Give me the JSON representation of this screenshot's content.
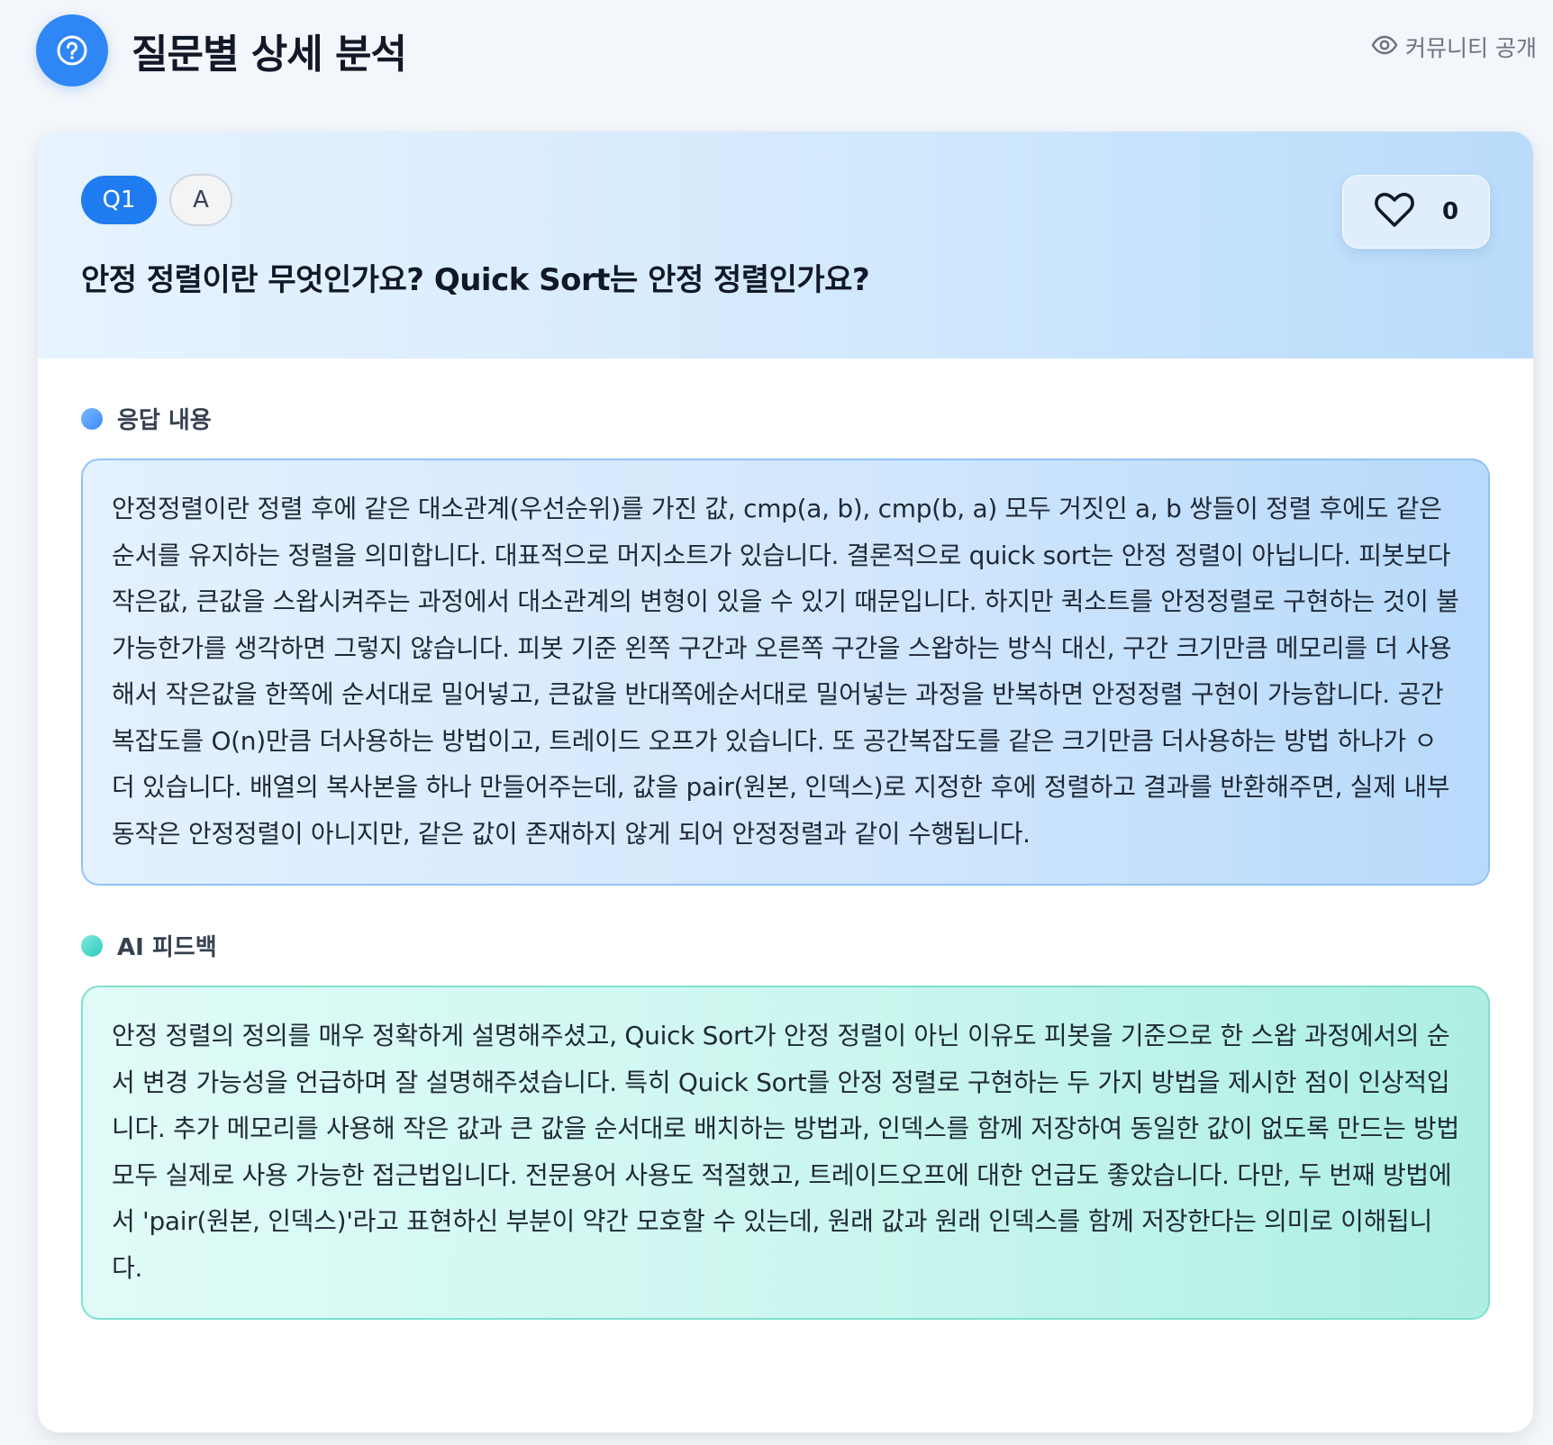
{
  "header": {
    "icon": "question-circle-icon",
    "title": "질문별 상세 분석",
    "community_label": "커뮤니티 공개",
    "community_icon": "eye-icon"
  },
  "question": {
    "number_badge": "Q1",
    "type_badge": "A",
    "text": "안정 정렬이란 무엇인가요? Quick Sort는 안정 정렬인가요?",
    "like_icon": "heart-icon",
    "like_count": "0"
  },
  "answer": {
    "label": "응답 내용",
    "text": "안정정렬이란 정렬 후에 같은 대소관계(우선순위)를 가진 값, cmp(a, b), cmp(b, a) 모두 거짓인 a, b 쌍들이 정렬 후에도 같은 순서를 유지하는 정렬을 의미합니다. 대표적으로 머지소트가 있습니다. 결론적으로 quick sort는 안정 정렬이 아닙니다. 피봇보다 작은값, 큰값을 스왑시켜주는 과정에서 대소관계의 변형이 있을 수 있기 때문입니다. 하지만 퀵소트를 안정정렬로 구현하는 것이 불가능한가를 생각하면 그렇지 않습니다. 피봇 기준 왼쪽 구간과 오른쪽 구간을 스왑하는 방식 대신, 구간 크기만큼 메모리를 더 사용해서 작은값을 한쪽에 순서대로 밀어넣고, 큰값을 반대쪽에순서대로 밀어넣는 과정을 반복하면 안정정렬 구현이 가능합니다. 공간복잡도를 O(n)만큼 더사용하는 방법이고, 트레이드 오프가 있습니다. 또 공간복잡도를 같은 크기만큼 더사용하는 방법 하나가 ㅇ더 있습니다. 배열의 복사본을 하나 만들어주는데, 값을 pair(원본, 인덱스)로 지정한 후에 정렬하고 결과를 반환해주면, 실제 내부 동작은 안정정렬이 아니지만, 같은 값이 존재하지 않게 되어 안정정렬과 같이 수행됩니다."
  },
  "feedback": {
    "label": "AI 피드백",
    "text": "안정 정렬의 정의를 매우 정확하게 설명해주셨고, Quick Sort가 안정 정렬이 아닌 이유도 피봇을 기준으로 한 스왑 과정에서의 순서 변경 가능성을 언급하며 잘 설명해주셨습니다. 특히 Quick Sort를 안정 정렬로 구현하는 두 가지 방법을 제시한 점이 인상적입니다. 추가 메모리를 사용해 작은 값과 큰 값을 순서대로 배치하는 방법과, 인덱스를 함께 저장하여 동일한 값이 없도록 만드는 방법 모두 실제로 사용 가능한 접근법입니다. 전문용어 사용도 적절했고, 트레이드오프에 대한 언급도 좋았습니다. 다만, 두 번째 방법에서 'pair(원본, 인덱스)'라고 표현하신 부분이 약간 모호할 수 있는데, 원래 값과 원래 인덱스를 함께 저장한다는 의미로 이해됩니다."
  }
}
